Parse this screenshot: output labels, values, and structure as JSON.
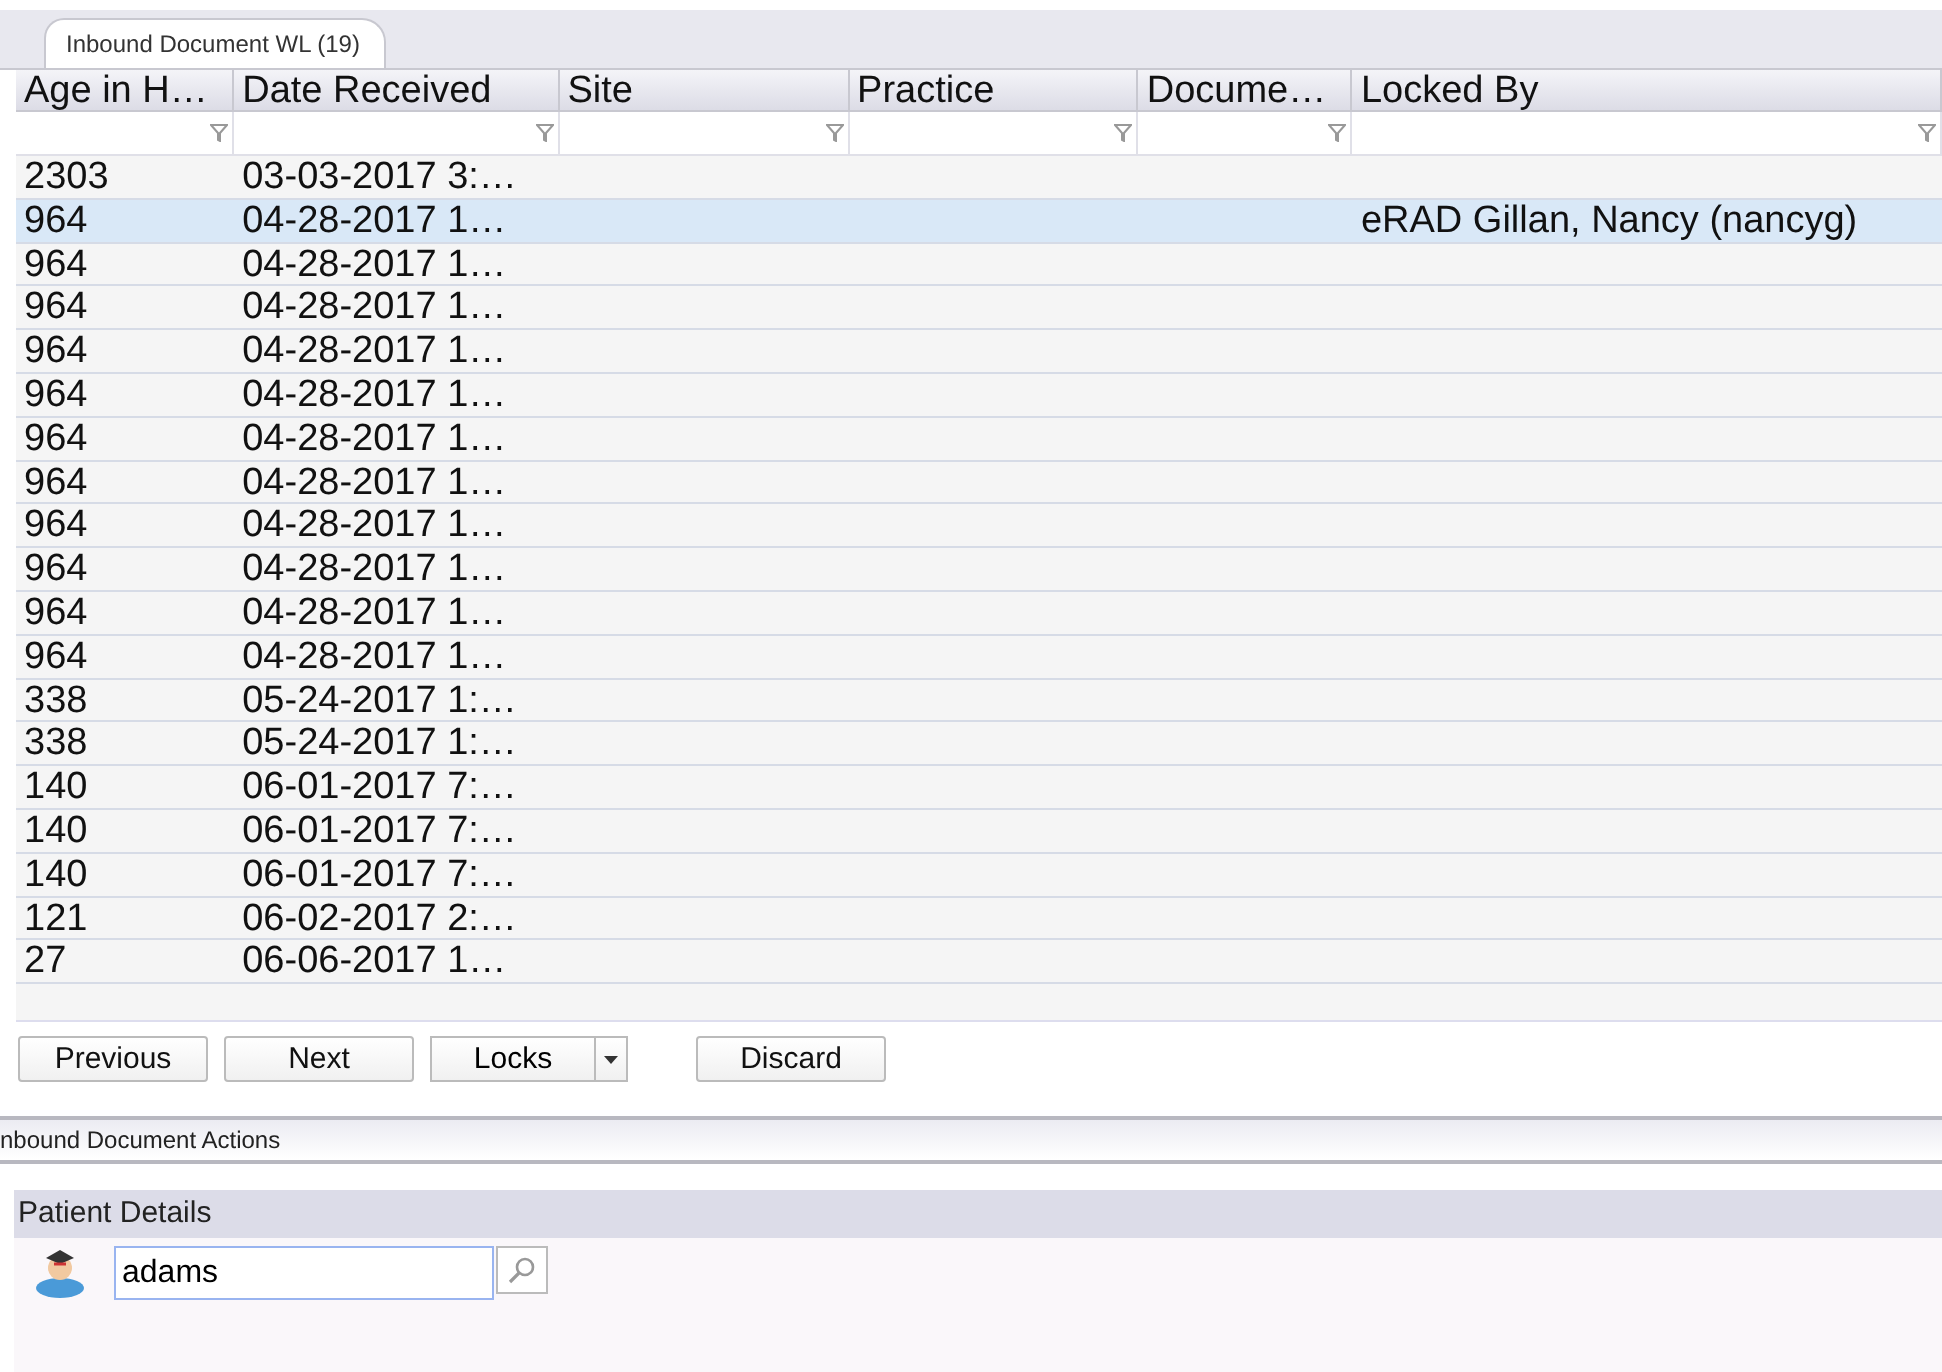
{
  "tabs": [
    {
      "label": "Inbound Document WL (19)",
      "selected": true
    }
  ],
  "table": {
    "columns": [
      "Age in H…",
      "Date Received",
      "Site",
      "Practice",
      "Docume…",
      "Locked By"
    ],
    "rows": [
      {
        "cells": [
          "2303",
          "03-03-2017  3:…",
          "",
          "",
          "",
          ""
        ],
        "selected": false
      },
      {
        "cells": [
          "964",
          "04-28-2017  1…",
          "",
          "",
          "",
          "eRAD Gillan, Nancy (nancyg)"
        ],
        "selected": true
      },
      {
        "cells": [
          "964",
          "04-28-2017  1…",
          "",
          "",
          "",
          ""
        ],
        "selected": false
      },
      {
        "cells": [
          "964",
          "04-28-2017  1…",
          "",
          "",
          "",
          ""
        ],
        "selected": false
      },
      {
        "cells": [
          "964",
          "04-28-2017  1…",
          "",
          "",
          "",
          ""
        ],
        "selected": false
      },
      {
        "cells": [
          "964",
          "04-28-2017  1…",
          "",
          "",
          "",
          ""
        ],
        "selected": false
      },
      {
        "cells": [
          "964",
          "04-28-2017  1…",
          "",
          "",
          "",
          ""
        ],
        "selected": false
      },
      {
        "cells": [
          "964",
          "04-28-2017  1…",
          "",
          "",
          "",
          ""
        ],
        "selected": false
      },
      {
        "cells": [
          "964",
          "04-28-2017  1…",
          "",
          "",
          "",
          ""
        ],
        "selected": false
      },
      {
        "cells": [
          "964",
          "04-28-2017  1…",
          "",
          "",
          "",
          ""
        ],
        "selected": false
      },
      {
        "cells": [
          "964",
          "04-28-2017  1…",
          "",
          "",
          "",
          ""
        ],
        "selected": false
      },
      {
        "cells": [
          "964",
          "04-28-2017  1…",
          "",
          "",
          "",
          ""
        ],
        "selected": false
      },
      {
        "cells": [
          "338",
          "05-24-2017  1:…",
          "",
          "",
          "",
          ""
        ],
        "selected": false
      },
      {
        "cells": [
          "338",
          "05-24-2017  1:…",
          "",
          "",
          "",
          ""
        ],
        "selected": false
      },
      {
        "cells": [
          "140",
          "06-01-2017  7:…",
          "",
          "",
          "",
          ""
        ],
        "selected": false
      },
      {
        "cells": [
          "140",
          "06-01-2017  7:…",
          "",
          "",
          "",
          ""
        ],
        "selected": false
      },
      {
        "cells": [
          "140",
          "06-01-2017  7:…",
          "",
          "",
          "",
          ""
        ],
        "selected": false
      },
      {
        "cells": [
          "121",
          "06-02-2017  2:…",
          "",
          "",
          "",
          ""
        ],
        "selected": false
      },
      {
        "cells": [
          "27",
          "06-06-2017  1…",
          "",
          "",
          "",
          ""
        ],
        "selected": false
      }
    ]
  },
  "buttons": [
    {
      "label": "Previous",
      "kind": "plain"
    },
    {
      "label": "Next",
      "kind": "plain"
    },
    {
      "label": "Locks",
      "kind": "split"
    },
    {
      "label": "Discard",
      "kind": "plain"
    }
  ],
  "actions_panel": {
    "title": "nbound Document Actions"
  },
  "patient_details": {
    "title": "Patient Details",
    "search_value": "adams"
  }
}
